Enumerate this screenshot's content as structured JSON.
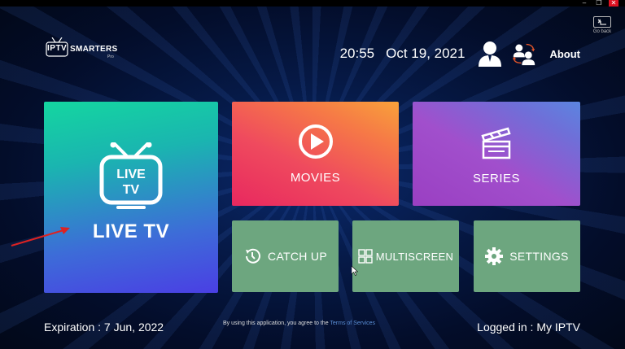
{
  "window": {
    "minimize": "–",
    "restore": "❐",
    "close": "✕"
  },
  "goback": {
    "label": "Go back",
    "icon": "back-arrow-icon"
  },
  "logo": {
    "iptv": "IPTV",
    "brand": "SMARTERS",
    "edition": "Pro"
  },
  "header": {
    "time": "20:55",
    "date": "Oct 19, 2021",
    "user_icon": "user-icon",
    "switch_icon": "switch-user-icon",
    "about": "About"
  },
  "tiles": {
    "live_tv": {
      "icon_text_line1": "LIVE",
      "icon_text_line2": "TV",
      "label": "LIVE TV"
    },
    "movies": {
      "label": "MOVIES",
      "icon": "play-icon"
    },
    "series": {
      "label": "SERIES",
      "icon": "clapperboard-icon"
    },
    "catch_up": {
      "label": "CATCH UP",
      "icon": "history-icon"
    },
    "multiscreen": {
      "label": "MULTISCREEN",
      "icon": "grid-icon"
    },
    "settings": {
      "label": "SETTINGS",
      "icon": "gear-icon"
    }
  },
  "footer": {
    "expiration": "Expiration : 7 Jun, 2022",
    "agreement_text": "By using this application, you agree to the ",
    "terms_link": "Terms of Services",
    "logged_in": "Logged in : My IPTV"
  },
  "colors": {
    "background": "#061a48",
    "live_tile_top": "#14d6a0",
    "live_tile_bottom": "#4a3fe4",
    "movies_tile": "#ef4a5e",
    "series_tile": "#a14fcc",
    "small_tiles": "#6da67f",
    "terms_link": "#5b8fd6",
    "annotation_arrow": "#d22"
  }
}
